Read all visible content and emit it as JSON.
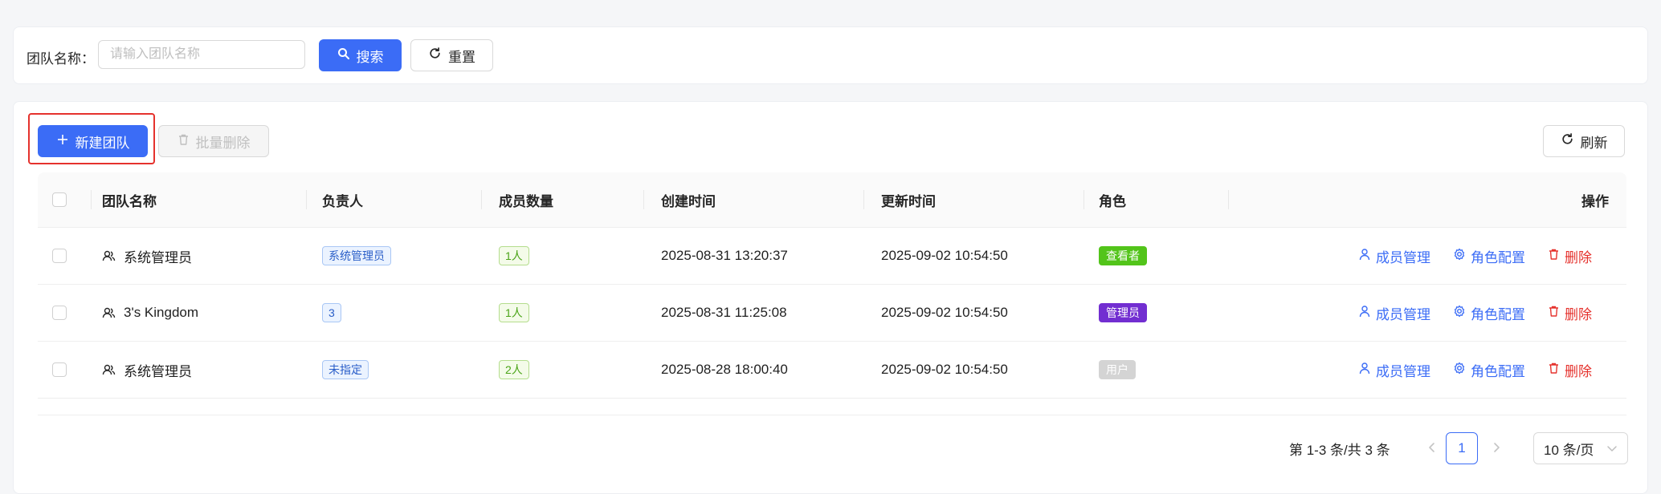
{
  "search": {
    "label": "团队名称：",
    "placeholder": "请输入团队名称",
    "value": "",
    "search_button": "搜索",
    "reset_button": "重置"
  },
  "toolbar": {
    "new_button": "新建团队",
    "batch_delete_button": "批量删除",
    "refresh_button": "刷新"
  },
  "table": {
    "headers": {
      "name": "团队名称",
      "owner": "负责人",
      "members": "成员数量",
      "created": "创建时间",
      "updated": "更新时间",
      "role": "角色",
      "actions": "操作"
    },
    "rows": [
      {
        "name": "系统管理员",
        "owner": "系统管理员",
        "members": "1人",
        "created": "2025-08-31 13:20:37",
        "updated": "2025-09-02 10:54:50",
        "role": "查看者",
        "role_color": "#52c41a"
      },
      {
        "name": "3's Kingdom",
        "owner": "3",
        "members": "1人",
        "created": "2025-08-31 11:25:08",
        "updated": "2025-09-02 10:54:50",
        "role": "管理员",
        "role_color": "#722ed1"
      },
      {
        "name": "系统管理员",
        "owner": "未指定",
        "members": "2人",
        "created": "2025-08-28 18:00:40",
        "updated": "2025-09-02 10:54:50",
        "role": "用户",
        "role_color": "#d4d4d4"
      }
    ],
    "actions": {
      "members": "成员管理",
      "role_config": "角色配置",
      "delete": "删除"
    }
  },
  "pagination": {
    "total_text": "第 1-3 条/共 3 条",
    "current_page": "1",
    "page_size": "10 条/页"
  },
  "colors": {
    "primary": "#3b6cf6",
    "danger": "#e5322d",
    "highlight_border": "#e5322d"
  }
}
